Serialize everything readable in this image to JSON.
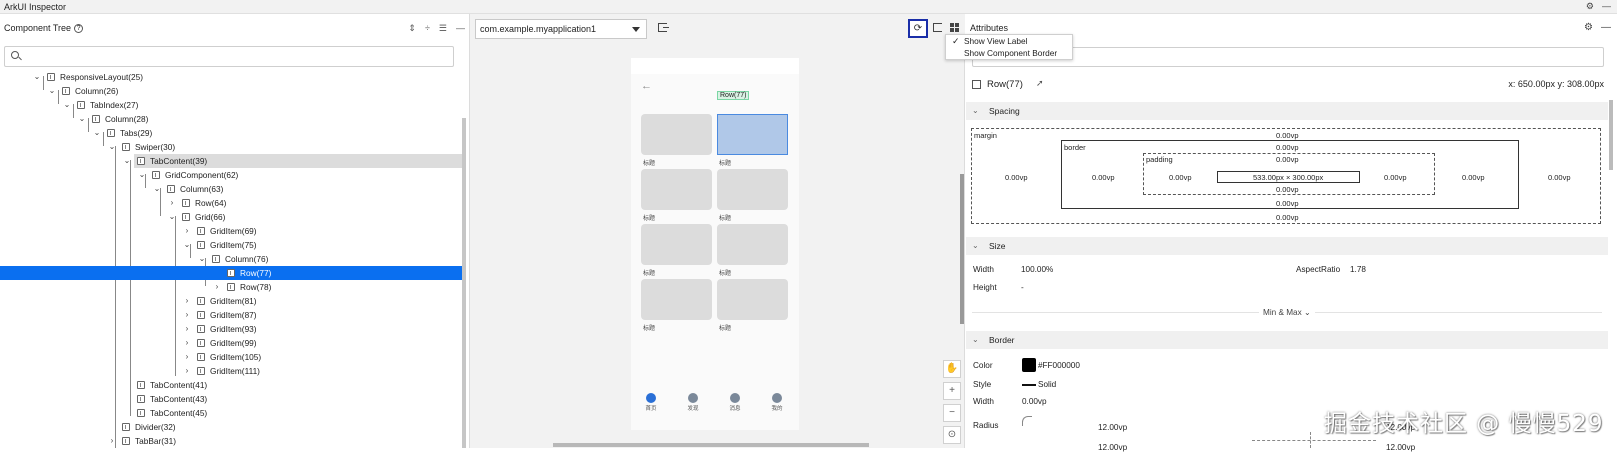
{
  "app": {
    "title": "ArkUI Inspector"
  },
  "left": {
    "title": "Component Tree",
    "search_placeholder": "",
    "tree": [
      {
        "label": "ResponsiveLayout(25)",
        "expanded": true
      },
      {
        "label": "Column(26)",
        "expanded": true
      },
      {
        "label": "TabIndex(27)",
        "expanded": true
      },
      {
        "label": "Column(28)",
        "expanded": true
      },
      {
        "label": "Tabs(29)",
        "expanded": true
      },
      {
        "label": "Swiper(30)",
        "expanded": true
      },
      {
        "label": "TabContent(39)",
        "expanded": true,
        "highlighted": true
      },
      {
        "label": "GridComponent(62)",
        "expanded": true
      },
      {
        "label": "Column(63)",
        "expanded": true
      },
      {
        "label": "Row(64)",
        "expanded": false
      },
      {
        "label": "Grid(66)",
        "expanded": true
      },
      {
        "label": "GridItem(69)",
        "expanded": false
      },
      {
        "label": "GridItem(75)",
        "expanded": true
      },
      {
        "label": "Column(76)",
        "expanded": true
      },
      {
        "label": "Row(77)",
        "selected": true
      },
      {
        "label": "Row(78)",
        "expanded": false
      },
      {
        "label": "GridItem(81)",
        "expanded": false
      },
      {
        "label": "GridItem(87)",
        "expanded": false
      },
      {
        "label": "GridItem(93)",
        "expanded": false
      },
      {
        "label": "GridItem(99)",
        "expanded": false
      },
      {
        "label": "GridItem(105)",
        "expanded": false
      },
      {
        "label": "GridItem(111)",
        "expanded": false
      },
      {
        "label": "TabContent(41)"
      },
      {
        "label": "TabContent(43)"
      },
      {
        "label": "TabContent(45)"
      },
      {
        "label": "Divider(32)"
      },
      {
        "label": "TabBar(31)",
        "expanded": false
      }
    ]
  },
  "middle": {
    "app_select": "com.example.myapplication1",
    "menu": [
      {
        "label": "Show View Label",
        "checked": true
      },
      {
        "label": "Show Component Border",
        "checked": false
      }
    ],
    "device": {
      "row_tag": "Row(77)",
      "card_label": "标题",
      "tabs": [
        "首页",
        "发现",
        "消息",
        "我的"
      ]
    },
    "zoom_tools": [
      "✋",
      "+",
      "−",
      "⊙"
    ]
  },
  "right": {
    "title": "Attributes",
    "search_placeholder": "",
    "component": "Row(77)",
    "position": "x: 650.00px  y: 308.00px",
    "spacing": {
      "title": "Spacing",
      "margin_label": "margin",
      "border_label": "border",
      "padding_label": "padding",
      "margin_top": "0.00vp",
      "margin_left": "0.00vp",
      "margin_right": "0.00vp",
      "margin_bottom": "0.00vp",
      "border_top": "0.00vp",
      "border_left": "0.00vp",
      "border_right": "0.00vp",
      "border_bottom": "0.00vp",
      "padding_top": "0.00vp",
      "padding_left": "0.00vp",
      "padding_right": "0.00vp",
      "padding_bottom": "0.00vp",
      "content": "533.00px × 300.00px"
    },
    "size": {
      "title": "Size",
      "width_label": "Width",
      "width_value": "100.00%",
      "height_label": "Height",
      "height_value": "-",
      "aspect_label": "AspectRatio",
      "aspect_value": "1.78",
      "minmax": "Min & Max"
    },
    "border": {
      "title": "Border",
      "color_label": "Color",
      "color_value": "#FF000000",
      "color_hex": "#000000",
      "style_label": "Style",
      "style_value": "Solid",
      "width_label": "Width",
      "width_value": "0.00vp",
      "radius_label": "Radius",
      "radius_value1": "12.00vp",
      "radius_value2": "12.00vp",
      "radius_value3": "12.00vp",
      "radius_value4": "12.00vp"
    }
  },
  "watermark": "掘金技术社区 @ 慢慢529"
}
